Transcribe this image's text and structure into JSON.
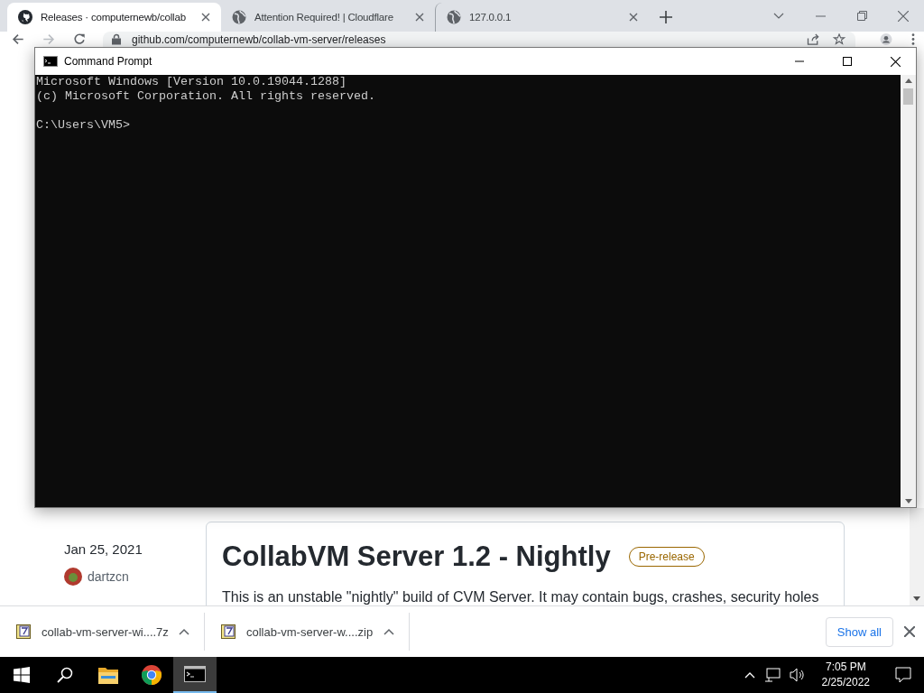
{
  "browser": {
    "tabs": [
      {
        "title": "Releases · computernewb/collab",
        "selected": true
      },
      {
        "title": "Attention Required! | Cloudflare",
        "selected": false
      },
      {
        "title": "127.0.0.1",
        "selected": false
      }
    ],
    "address": "github.com/computernewb/collab-vm-server/releases"
  },
  "page": {
    "date": "Jan 25, 2021",
    "author": "dartzcn",
    "release_title": "CollabVM Server 1.2 - Nightly",
    "badge": "Pre-release",
    "description": "This is an unstable \"nightly\" build of CVM Server. It may contain bugs, crashes, security holes"
  },
  "downloads": {
    "items": [
      {
        "name": "collab-vm-server-wi....7z"
      },
      {
        "name": "collab-vm-server-w....zip"
      }
    ],
    "show_all": "Show all"
  },
  "console": {
    "title": "Command Prompt",
    "lines": [
      "Microsoft Windows [Version 10.0.19044.1288]",
      "(c) Microsoft Corporation. All rights reserved."
    ],
    "prompt": "C:\\Users\\VM5>"
  },
  "taskbar": {
    "apps": [
      {
        "kind": "explorer",
        "selected": false
      },
      {
        "kind": "chrome",
        "selected": false
      },
      {
        "kind": "cmd",
        "selected": true
      }
    ],
    "time": "7:05 PM",
    "date": "2/25/2022"
  }
}
